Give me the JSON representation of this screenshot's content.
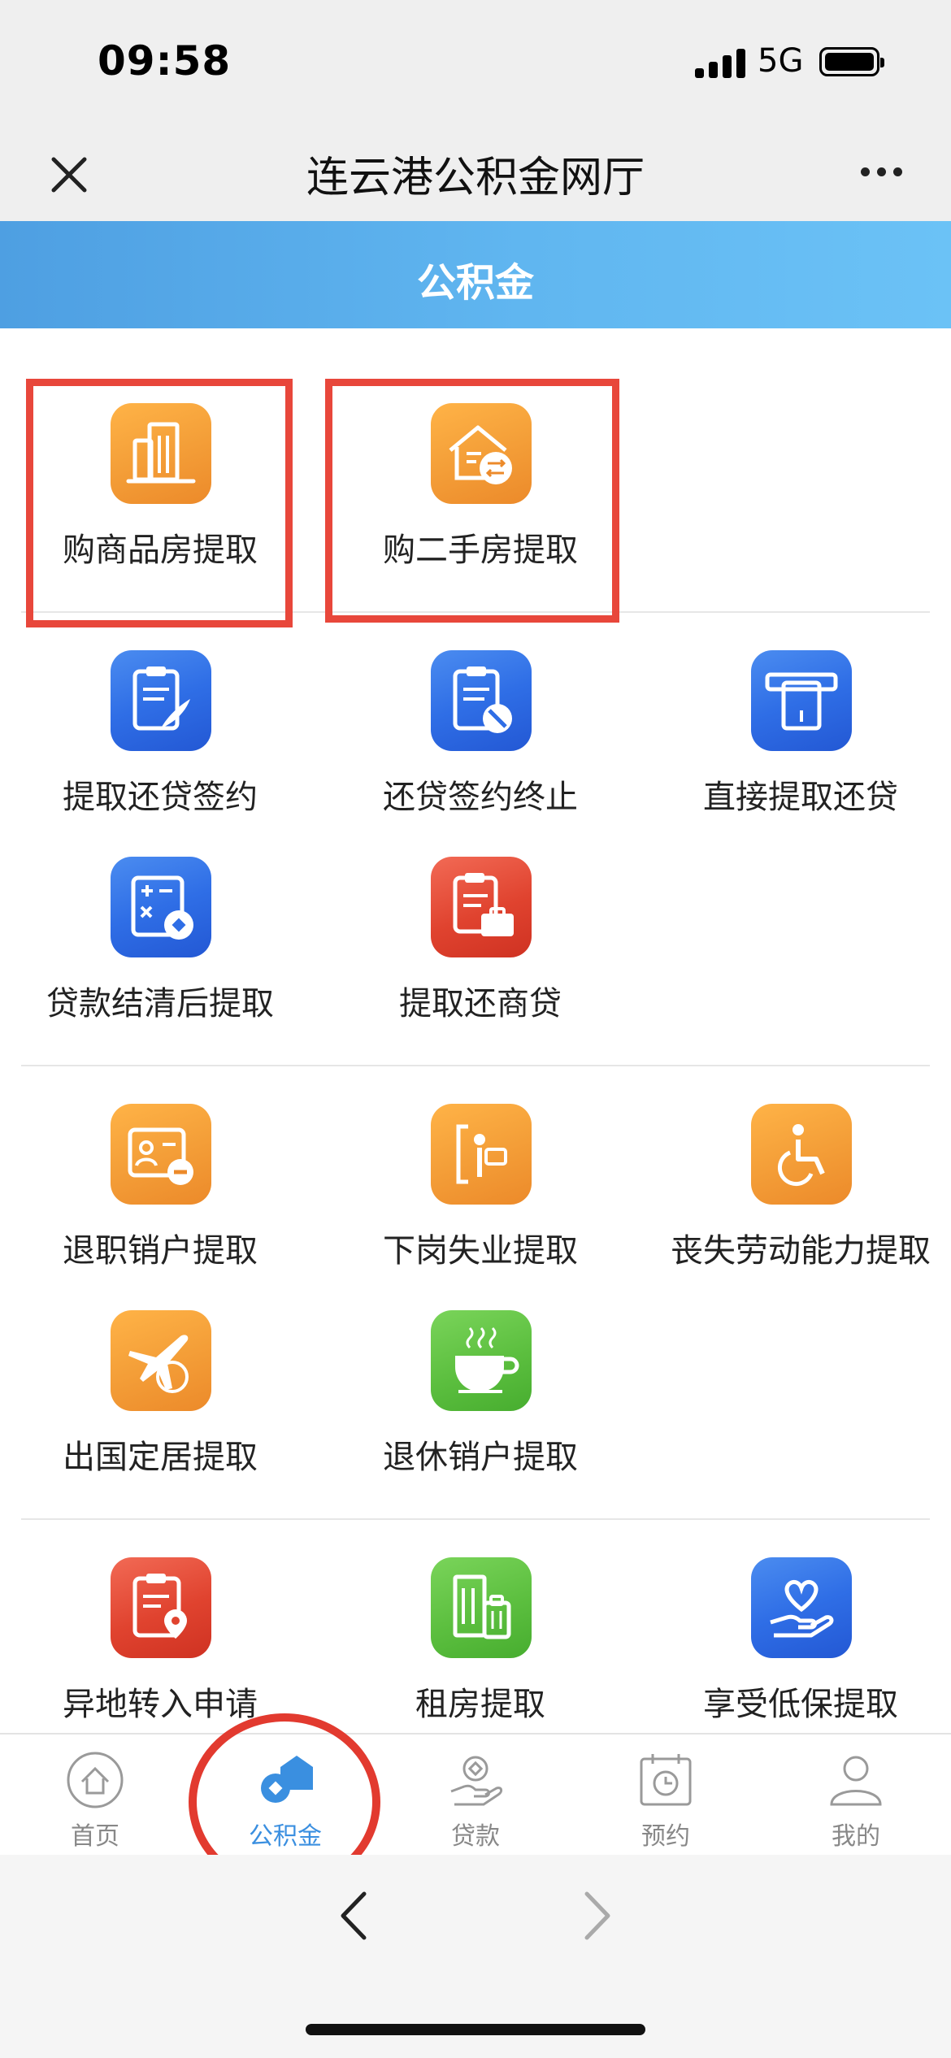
{
  "status_bar": {
    "time": "09:58",
    "network": "5G"
  },
  "nav": {
    "title": "连云港公积金网厅"
  },
  "header": {
    "title": "公积金"
  },
  "sections": [
    {
      "items": [
        {
          "label": "购商品房提取",
          "icon": "building-icon",
          "color": "#f5a13a"
        },
        {
          "label": "购二手房提取",
          "icon": "house-exchange-icon",
          "color": "#f5a13a"
        }
      ]
    },
    {
      "items": [
        {
          "label": "提取还贷签约",
          "icon": "sign-document-icon",
          "color": "#2f6ee6"
        },
        {
          "label": "还贷签约终止",
          "icon": "terminate-document-icon",
          "color": "#2f6ee6"
        },
        {
          "label": "直接提取还贷",
          "icon": "atm-card-icon",
          "color": "#2f6ee6"
        },
        {
          "label": "贷款结清后提取",
          "icon": "calculator-icon",
          "color": "#2f6ee6"
        },
        {
          "label": "提取还商贷",
          "icon": "briefcase-document-icon",
          "color": "#e0432f"
        }
      ]
    },
    {
      "items": [
        {
          "label": "退职销户提取",
          "icon": "id-card-minus-icon",
          "color": "#f5a13a"
        },
        {
          "label": "下岗失业提取",
          "icon": "person-exit-icon",
          "color": "#f5a13a"
        },
        {
          "label": "丧失劳动能力提取",
          "icon": "wheelchair-icon",
          "color": "#f5a13a"
        },
        {
          "label": "出国定居提取",
          "icon": "plane-globe-icon",
          "color": "#f5a13a"
        },
        {
          "label": "退休销户提取",
          "icon": "coffee-cup-icon",
          "color": "#5cbf3f"
        }
      ]
    },
    {
      "items": [
        {
          "label": "异地转入申请",
          "icon": "location-document-icon",
          "color": "#e0432f"
        },
        {
          "label": "租房提取",
          "icon": "building-luggage-icon",
          "color": "#5cbf3f"
        },
        {
          "label": "享受低保提取",
          "icon": "heart-hand-icon",
          "color": "#2f6ee6"
        }
      ]
    }
  ],
  "tabbar": {
    "tabs": [
      {
        "label": "首页",
        "icon": "home-icon"
      },
      {
        "label": "公积金",
        "icon": "fund-house-icon",
        "active": true
      },
      {
        "label": "贷款",
        "icon": "loan-hand-icon"
      },
      {
        "label": "预约",
        "icon": "calendar-clock-icon"
      },
      {
        "label": "我的",
        "icon": "user-icon"
      }
    ]
  },
  "colors": {
    "header_blue": "#60b6f0",
    "active_tab": "#3a8fe0",
    "annotation_red": "#e23a2f"
  }
}
